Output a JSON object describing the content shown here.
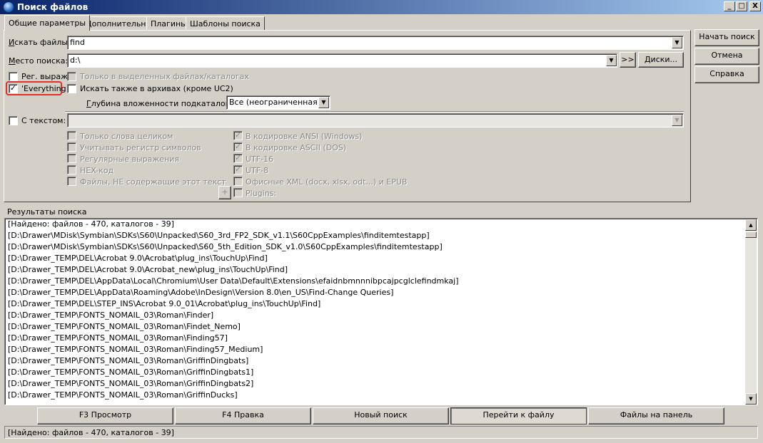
{
  "window": {
    "title": "Поиск файлов",
    "controls": [
      "_",
      "□",
      "X"
    ]
  },
  "tabs": [
    {
      "label": "Общие параметры",
      "active": true
    },
    {
      "label": "Дополнительно",
      "active": false
    },
    {
      "label": "Плагины",
      "active": false
    },
    {
      "label": "Шаблоны поиска",
      "active": false
    }
  ],
  "general": {
    "search_files_label_u": "И",
    "search_files_label_rest": "скать файлы:",
    "search_files_value": "find",
    "search_place_label_u": "М",
    "search_place_label_rest": "есто поиска:",
    "search_place_value": "d:\\",
    "browse_button": ">>",
    "drives_button": "Диски...",
    "regex_checkbox_label": "Рег. выраж",
    "regex_checked": false,
    "everything_checkbox_label": "'Everything",
    "everything_checked": true,
    "selected_only_label": "Только в выделенных файлах/каталогах",
    "archives_label": "Искать также в архивах (кроме UC2)",
    "depth_label_u": "Г",
    "depth_label_rest": "лубина вложенности подкаталогов:",
    "depth_value": "Все (неограниченная)"
  },
  "text_search": {
    "label": "С текстом:",
    "checked": false,
    "value": "",
    "options_left": [
      "Только слова целиком",
      "Учитывать регистр символов",
      "Регулярные выражения",
      "HEX-код",
      "Файлы, НЕ содержащие этот текст"
    ],
    "options_right": [
      {
        "label": "В кодировке ANSI (Windows)",
        "checked": true
      },
      {
        "label": "В кодировке ASCII (DOS)",
        "checked": true
      },
      {
        "label": "UTF-16",
        "checked": true
      },
      {
        "label": "UTF-8",
        "checked": true
      },
      {
        "label": "Офисные XML (docx, xlsx, odt...) и EPUB",
        "checked": false
      },
      {
        "label": "Plugins:",
        "checked": false
      }
    ],
    "plus_button": "+"
  },
  "side_buttons": {
    "start": "Начать поиск",
    "cancel": "Отмена",
    "help": "Справка"
  },
  "results": {
    "header": "Результаты поиска",
    "lines": [
      "[Найдено: файлов - 470, каталогов - 39]",
      "[D:\\Drawer\\MDisk\\Symbian\\SDKs\\S60\\Unpacked\\S60_3rd_FP2_SDK_v1.1\\S60CppExamples\\finditemtestapp]",
      "[D:\\Drawer\\MDisk\\Symbian\\SDKs\\S60\\Unpacked\\S60_5th_Edition_SDK_v1.0\\S60CppExamples\\finditemtestapp]",
      "[D:\\Drawer_TEMP\\DEL\\Acrobat 9.0\\Acrobat\\plug_ins\\TouchUp\\Find]",
      "[D:\\Drawer_TEMP\\DEL\\Acrobat 9.0\\Acrobat_new\\plug_ins\\TouchUp\\Find]",
      "[D:\\Drawer_TEMP\\DEL\\AppData\\Local\\Chromium\\User Data\\Default\\Extensions\\efaidnbmnnnibpcajpcglclefindmkaj]",
      "[D:\\Drawer_TEMP\\DEL\\AppData\\Roaming\\Adobe\\InDesign\\Version 8.0\\en_US\\Find-Change Queries]",
      "[D:\\Drawer_TEMP\\DEL\\STEP_INS\\Acrobat 9.0_01\\Acrobat\\plug_ins\\TouchUp\\Find]",
      "[D:\\Drawer_TEMP\\FONTS_NOMAIL_03\\Roman\\Finder]",
      "[D:\\Drawer_TEMP\\FONTS_NOMAIL_03\\Roman\\Findet_Nemo]",
      "[D:\\Drawer_TEMP\\FONTS_NOMAIL_03\\Roman\\Finding57]",
      "[D:\\Drawer_TEMP\\FONTS_NOMAIL_03\\Roman\\Finding57_Medium]",
      "[D:\\Drawer_TEMP\\FONTS_NOMAIL_03\\Roman\\GriffinDingbats]",
      "[D:\\Drawer_TEMP\\FONTS_NOMAIL_03\\Roman\\GriffinDingbats1]",
      "[D:\\Drawer_TEMP\\FONTS_NOMAIL_03\\Roman\\GriffinDingbats2]",
      "[D:\\Drawer_TEMP\\FONTS_NOMAIL_03\\Roman\\GriffinDucks]"
    ]
  },
  "bottom_buttons": {
    "view": "F3 Просмотр",
    "edit": "F4 Правка",
    "new_search": "Новый поиск",
    "goto_file": "Перейти к файлу",
    "to_panel": "Файлы на панель"
  },
  "status_text": "[Найдено: файлов - 470, каталогов - 39]"
}
